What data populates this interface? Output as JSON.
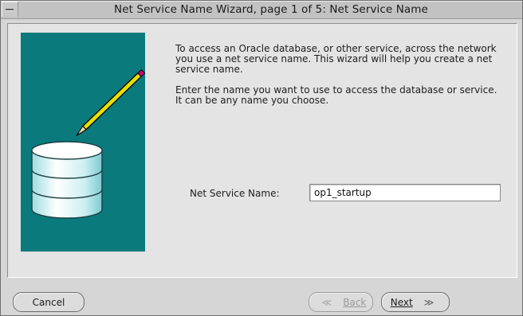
{
  "window": {
    "title": "Net Service Name Wizard, page 1 of 5: Net Service Name"
  },
  "illustration": {
    "icon": "database-pencil-icon"
  },
  "intro": {
    "paragraph_1": "To access an Oracle database, or other service, across the network you use a net service name.  This wizard will help you create a net service name.",
    "paragraph_2": "Enter the name you want to use to access the database or service.  It can be any name you choose."
  },
  "form": {
    "net_service_name_label": "Net Service Name:",
    "net_service_name_value": "op1_startup"
  },
  "buttons": {
    "cancel": "Cancel",
    "back": "Back",
    "back_enabled": false,
    "next": "Next",
    "back_arrow": "≪",
    "next_arrow": "≫"
  },
  "colors": {
    "illustration_background": "#0a7a7d",
    "window_background": "#d6d6d6"
  }
}
